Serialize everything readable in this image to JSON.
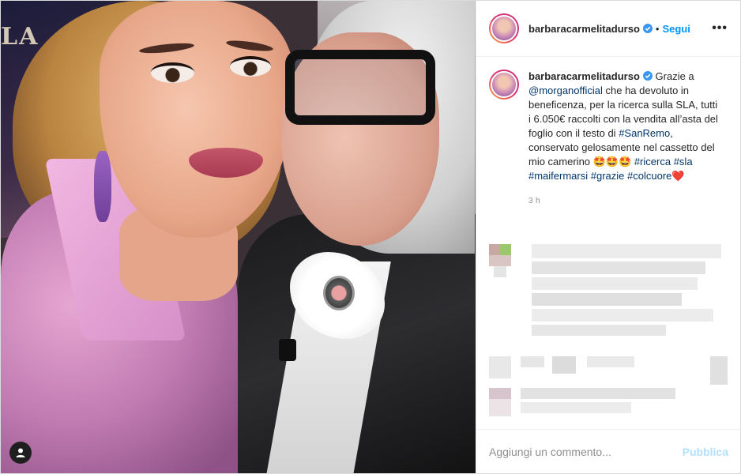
{
  "post": {
    "username": "barbaracarmelitadurso",
    "follow_label": "Segui",
    "separator": "•",
    "more_icon": "more-horizontal-icon",
    "verified_icon": "verified-badge-icon",
    "photo_sign_text": "LA"
  },
  "caption": {
    "username": "barbaracarmelitadurso",
    "text_1": "Grazie a ",
    "mention": "@morganofficial",
    "text_2": " che ha devoluto in beneficenza, per la ricerca sulla SLA, tutti i 6.050€ raccolti con la vendita all’asta del foglio con il testo di ",
    "tag_sanremo": "#SanRemo",
    "text_3": ", conservato gelosamente nel cassetto del mio camerino 🤩🤩🤩",
    "tag_ricerca": "#ricerca",
    "tag_sla": "#sla",
    "tag_maifermarsi": "#maifermarsi",
    "tag_grazie": "#grazie",
    "tag_colcuore": "#colcuore",
    "heart": "❤️",
    "time": "3 h"
  },
  "comment_box": {
    "placeholder": "Aggiungi un commento...",
    "publish_label": "Pubblica"
  },
  "colors": {
    "link": "#00376b",
    "follow": "#0095f6",
    "publish_disabled": "#b2dffc",
    "muted": "#8e8e8e"
  }
}
